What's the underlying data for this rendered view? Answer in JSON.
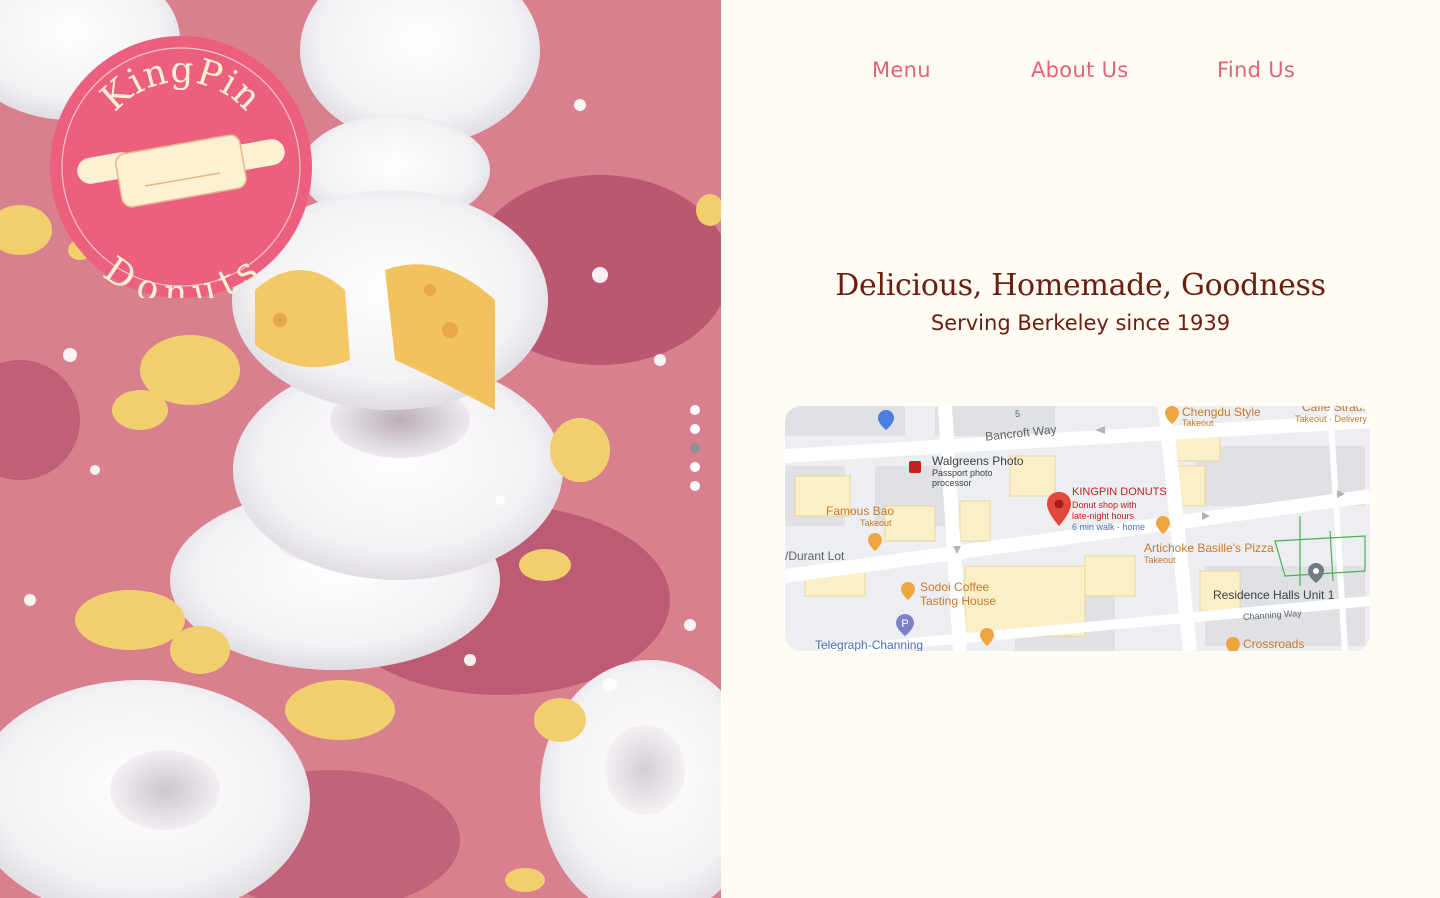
{
  "logo": {
    "top_text": "KingPin",
    "bottom_text": "Donuts"
  },
  "nav": {
    "items": [
      "Menu",
      "About Us",
      "Find Us"
    ]
  },
  "hero": {
    "slides_count": 5,
    "active_slide": 3,
    "colors": {
      "background": "#d6808e",
      "accent": "#e8607a"
    }
  },
  "main": {
    "headline": "Delicious, Homemade, Goodness",
    "subheadline": "Serving Berkeley since 1939"
  },
  "map": {
    "streets": [
      "Bancroft Way",
      "/Durant Lot",
      "Channing Way",
      "5"
    ],
    "pois": [
      {
        "name": "Chengdu Style",
        "sub": "Takeout"
      },
      {
        "name": "Caffe Strada",
        "sub": "Takeout · Delivery"
      },
      {
        "name": "Walgreens Photo",
        "sub": "Passport photo processor"
      },
      {
        "name": "Famous Bao",
        "sub": "Takeout"
      },
      {
        "name": "Artichoke Basille's Pizza",
        "sub": "Takeout"
      },
      {
        "name": "Sodoi Coffee Tasting House",
        "sub": ""
      },
      {
        "name": "Residence Halls Unit 1",
        "sub": ""
      },
      {
        "name": "Crossroads",
        "sub": ""
      },
      {
        "name": "Telegraph-Channing",
        "sub": ""
      }
    ],
    "main_pin": {
      "name": "KINGPIN DONUTS",
      "desc1": "Donut shop with",
      "desc2": "late-night hours",
      "walk": "6 min walk · home"
    }
  }
}
